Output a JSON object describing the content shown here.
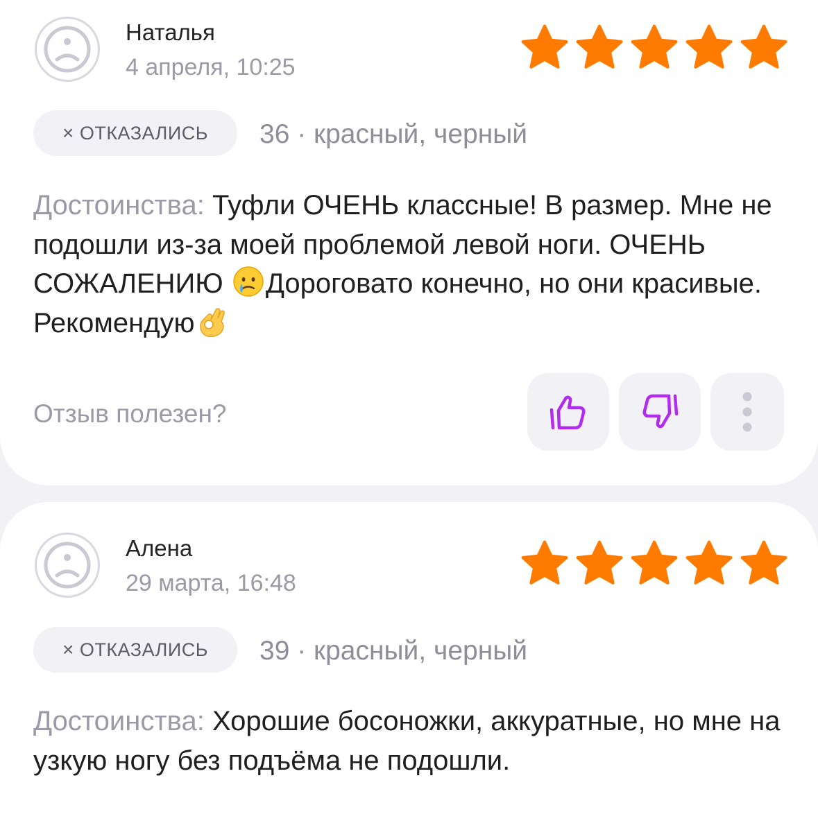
{
  "reviews": [
    {
      "author": "Наталья",
      "date": "4 апреля, 10:25",
      "rating": 5,
      "status_x": "×",
      "status": "ОТКАЗАЛИСЬ",
      "variant": "36 · красный, черный",
      "pros_label": "Достоинства:",
      "pros_text_1": " Туфли ОЧЕНЬ классные! В размер. Мне не подошли из-за моей проблемой левой ноги. ОЧЕНЬ СОЖАЛЕНИЮ ",
      "emoji_1": "crying-face",
      "pros_text_2": "Дороговато конечно, но они красивые. Рекомендую",
      "emoji_2": "ok-hand",
      "helpful_label": "Отзыв полезен?",
      "like_icon": "thumbs-up-icon",
      "dislike_icon": "thumbs-down-icon",
      "more_icon": "more-vertical-icon"
    },
    {
      "author": "Алена",
      "date": "29 марта, 16:48",
      "rating": 5,
      "status_x": "×",
      "status": "ОТКАЗАЛИСЬ",
      "variant": "39 · красный, черный",
      "pros_label": "Достоинства:",
      "pros_text": " Хорошие босоножки, аккуратные, но мне на узкую ногу без подъёма не подошли."
    }
  ],
  "colors": {
    "star": "#ff7b00",
    "accent": "#b22cf0",
    "muted": "#9b9aa6",
    "background": "#f2f1f5"
  }
}
